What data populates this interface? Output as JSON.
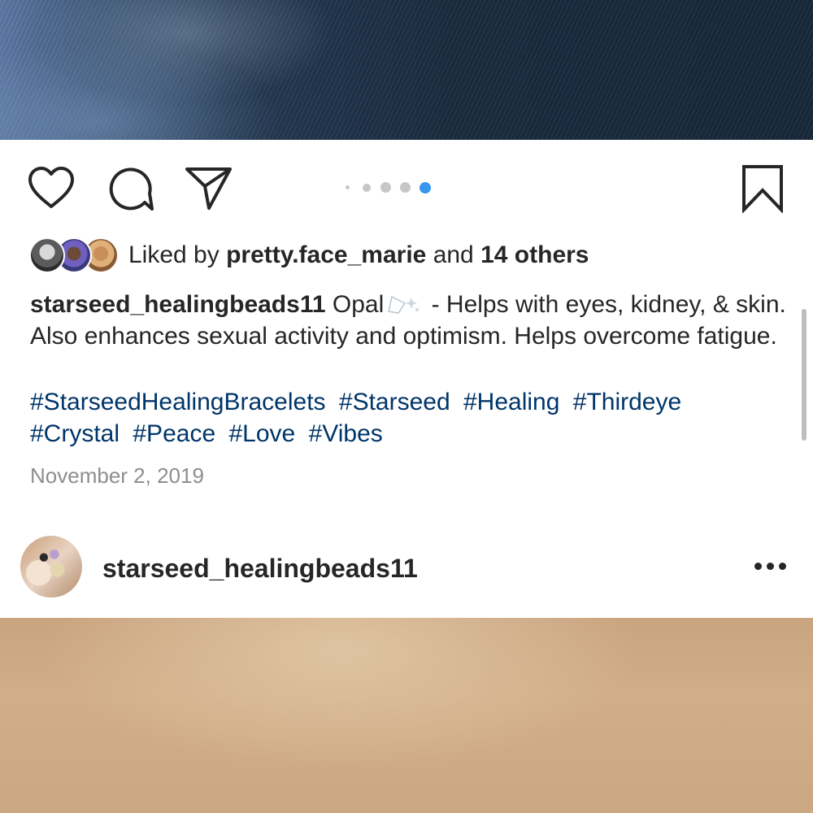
{
  "carousel": {
    "count": 5,
    "active_index": 4
  },
  "likes": {
    "prefix": "Liked by",
    "user": "pretty.face_marie",
    "conjunction": "and",
    "others": "14 others"
  },
  "caption": {
    "username": "starseed_healingbeads11",
    "text_before_emoji": "Opal",
    "text_after_emoji": "- Helps with eyes, kidney, & skin. Also enhances sexual activity and optimism. Helps overcome fatigue."
  },
  "hashtags": [
    "#StarseedHealingBracelets",
    "#Starseed",
    "#Healing",
    "#Thirdeye",
    "#Crystal",
    "#Peace",
    "#Love",
    "#Vibes"
  ],
  "date": "November 2, 2019",
  "next_post": {
    "username": "starseed_healingbeads11"
  },
  "colors": {
    "hashtag": "#003569",
    "active_dot": "#3897f0",
    "muted": "#8e8e8e"
  }
}
